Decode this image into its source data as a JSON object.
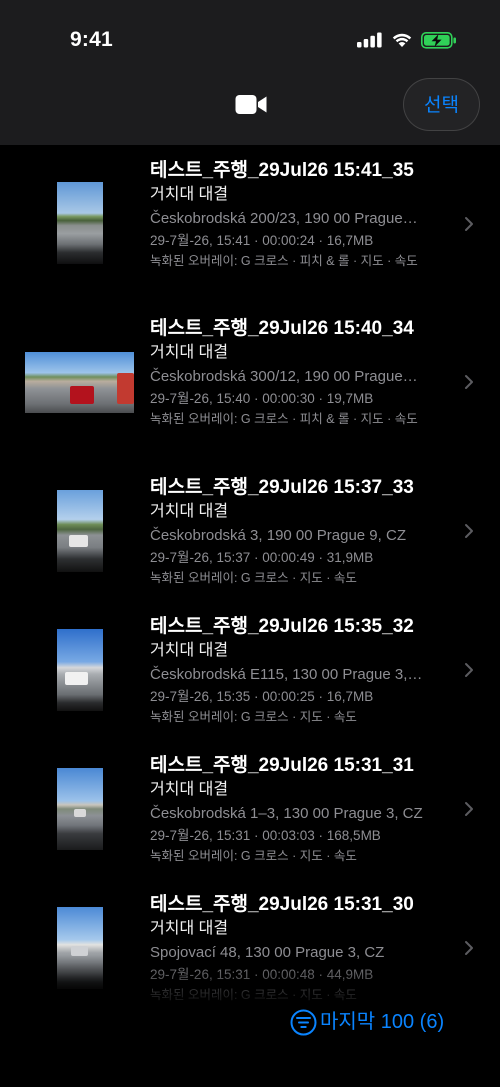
{
  "status_bar": {
    "time": "9:41",
    "icons": [
      "cellular-signal-icon",
      "wifi-icon",
      "battery-charging-icon"
    ]
  },
  "header": {
    "icon": "video-camera-icon",
    "select_label": "선택"
  },
  "recordings": [
    {
      "title": "테스트_주행_29Jul26 15:41_35",
      "subtitle": "거치대 대결",
      "location": "Českobrodská 200/23, 190 00 Prague…",
      "details": "29-7월-26, 15:41 · 00:00:24 · 16,7MB",
      "overlays": "녹화된 오버레이: G 크로스 · 피치 & 롤 · 지도 · 속도"
    },
    {
      "title": "테스트_주행_29Jul26 15:40_34",
      "subtitle": "거치대 대결",
      "location": "Českobrodská 300/12, 190 00 Prague…",
      "details": "29-7월-26, 15:40 · 00:00:30 · 19,7MB",
      "overlays": "녹화된 오버레이: G 크로스 · 피치 & 롤 · 지도 · 속도"
    },
    {
      "title": "테스트_주행_29Jul26 15:37_33",
      "subtitle": "거치대 대결",
      "location": "Českobrodská 3, 190 00 Prague 9, CZ",
      "details": "29-7월-26, 15:37 · 00:00:49 · 31,9MB",
      "overlays": "녹화된 오버레이: G 크로스 · 지도 · 속도"
    },
    {
      "title": "테스트_주행_29Jul26 15:35_32",
      "subtitle": "거치대 대결",
      "location": "Českobrodská E115, 130 00 Prague 3,…",
      "details": "29-7월-26, 15:35 · 00:00:25 · 16,7MB",
      "overlays": "녹화된 오버레이: G 크로스 · 지도 · 속도"
    },
    {
      "title": "테스트_주행_29Jul26 15:31_31",
      "subtitle": "거치대 대결",
      "location": "Českobrodská 1–3, 130 00 Prague 3, CZ",
      "details": "29-7월-26, 15:31 · 00:03:03 · 168,5MB",
      "overlays": "녹화된 오버레이: G 크로스 · 지도 · 속도"
    },
    {
      "title": "테스트_주행_29Jul26 15:31_30",
      "subtitle": "거치대 대결",
      "location": "Spojovací 48, 130 00 Prague 3, CZ",
      "details": "29-7월-26, 15:31 · 00:00:48 · 44,9MB",
      "overlays": "녹화된 오버레이: G 크로스 · 지도 · 속도"
    }
  ],
  "footer": {
    "filter_icon": "filter-circle-icon",
    "filter_label": "마지막 100 (6)"
  },
  "colors": {
    "accent": "#0a84ff",
    "secondary_text": "#8e8e93",
    "battery": "#30d158",
    "header_background": "#1c1c1e",
    "background": "#000000"
  }
}
